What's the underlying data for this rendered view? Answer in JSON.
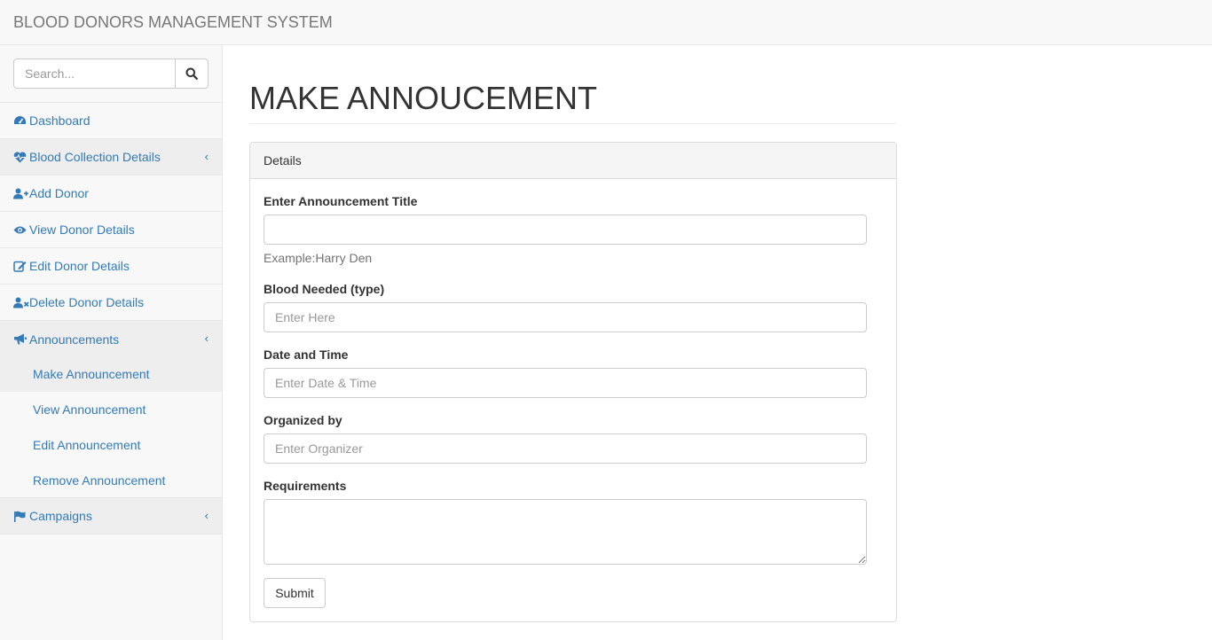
{
  "app": {
    "brand": "BLOOD DONORS MANAGEMENT SYSTEM"
  },
  "sidebar": {
    "search_placeholder": "Search...",
    "items": [
      {
        "label": "Dashboard",
        "icon": "dashboard-icon"
      },
      {
        "label": "Blood Collection Details",
        "icon": "heartbeat-icon",
        "chevron": "‹"
      },
      {
        "label": "Add Donor",
        "icon": "user-plus-icon"
      },
      {
        "label": "View Donor Details",
        "icon": "eye-icon"
      },
      {
        "label": "Edit Donor Details",
        "icon": "edit-icon"
      },
      {
        "label": "Delete Donor Details",
        "icon": "user-times-icon"
      },
      {
        "label": "Announcements",
        "icon": "bullhorn-icon",
        "chevron": "‹"
      },
      {
        "label": "Campaigns",
        "icon": "flag-icon",
        "chevron": "‹"
      }
    ],
    "announcements_sub": [
      {
        "label": "Make Announcement"
      },
      {
        "label": "View Announcement"
      },
      {
        "label": "Edit Announcement"
      },
      {
        "label": "Remove Announcement"
      }
    ]
  },
  "main": {
    "title": "MAKE ANNOUCEMENT",
    "panel_heading": "Details",
    "form": {
      "title_label": "Enter Announcement Title",
      "title_value": "",
      "title_help": "Example:Harry Den",
      "blood_label": "Blood Needed (type)",
      "blood_placeholder": "Enter Here",
      "datetime_label": "Date and Time",
      "datetime_placeholder": "Enter Date & Time",
      "organizer_label": "Organized by",
      "organizer_placeholder": "Enter Organizer",
      "requirements_label": "Requirements",
      "requirements_value": "",
      "submit_label": "Submit"
    }
  },
  "colors": {
    "link": "#337ab7",
    "navbar_bg": "#f8f8f8",
    "active_bg": "#eeeeee"
  }
}
